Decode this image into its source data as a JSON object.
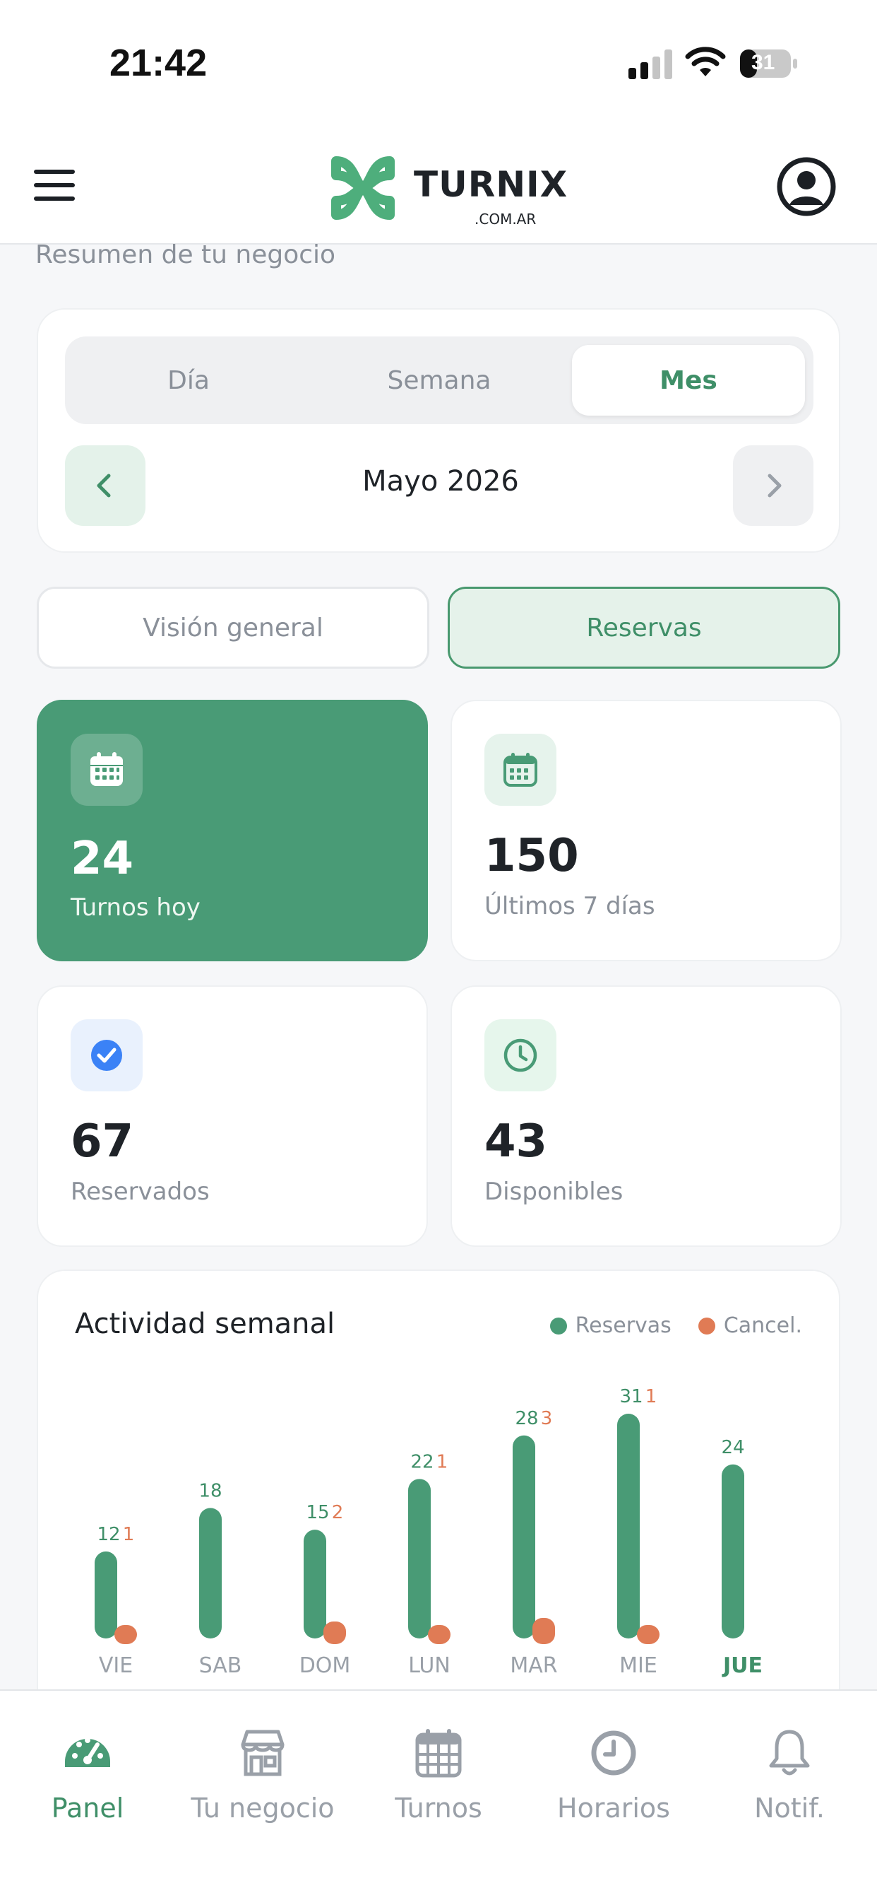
{
  "status_bar": {
    "time": "21:42",
    "battery": "31"
  },
  "header": {
    "logo_text": "TURNIX",
    "logo_sub": ".COM.AR"
  },
  "subtitle": "Resumen de tu negocio",
  "period": {
    "tabs": [
      "Día",
      "Semana",
      "Mes"
    ],
    "active_tab": "Mes",
    "label": "Mayo 2026"
  },
  "views": {
    "general": "Visión general",
    "reservas": "Reservas",
    "active": "Reservas"
  },
  "stats": [
    {
      "value": "24",
      "label": "Turnos hoy",
      "icon": "calendar-icon"
    },
    {
      "value": "150",
      "label": "Últimos 7 días",
      "icon": "calendar-icon"
    },
    {
      "value": "67",
      "label": "Reservados",
      "icon": "check-icon"
    },
    {
      "value": "43",
      "label": "Disponibles",
      "icon": "clock-icon"
    }
  ],
  "colors": {
    "primary": "#499b76",
    "cancel": "#e07b55",
    "accent_text": "#3f8f68"
  },
  "chart_data": {
    "type": "bar",
    "title": "Actividad semanal",
    "categories": [
      "VIE",
      "SAB",
      "DOM",
      "LUN",
      "MAR",
      "MIE",
      "JUE"
    ],
    "highlight_category": "JUE",
    "series": [
      {
        "name": "Reservas",
        "values": [
          12,
          18,
          15,
          22,
          28,
          31,
          24
        ]
      },
      {
        "name": "Cancel.",
        "values": [
          1,
          0,
          2,
          1,
          3,
          1,
          0
        ]
      }
    ],
    "legend_position": "top-right",
    "grid": false
  },
  "bottom_nav": [
    {
      "label": "Panel",
      "icon": "gauge-icon",
      "active": true
    },
    {
      "label": "Tu negocio",
      "icon": "store-icon",
      "active": false
    },
    {
      "label": "Turnos",
      "icon": "calendar-icon",
      "active": false
    },
    {
      "label": "Horarios",
      "icon": "clock-icon",
      "active": false
    },
    {
      "label": "Notif.",
      "icon": "bell-icon",
      "active": false
    }
  ]
}
